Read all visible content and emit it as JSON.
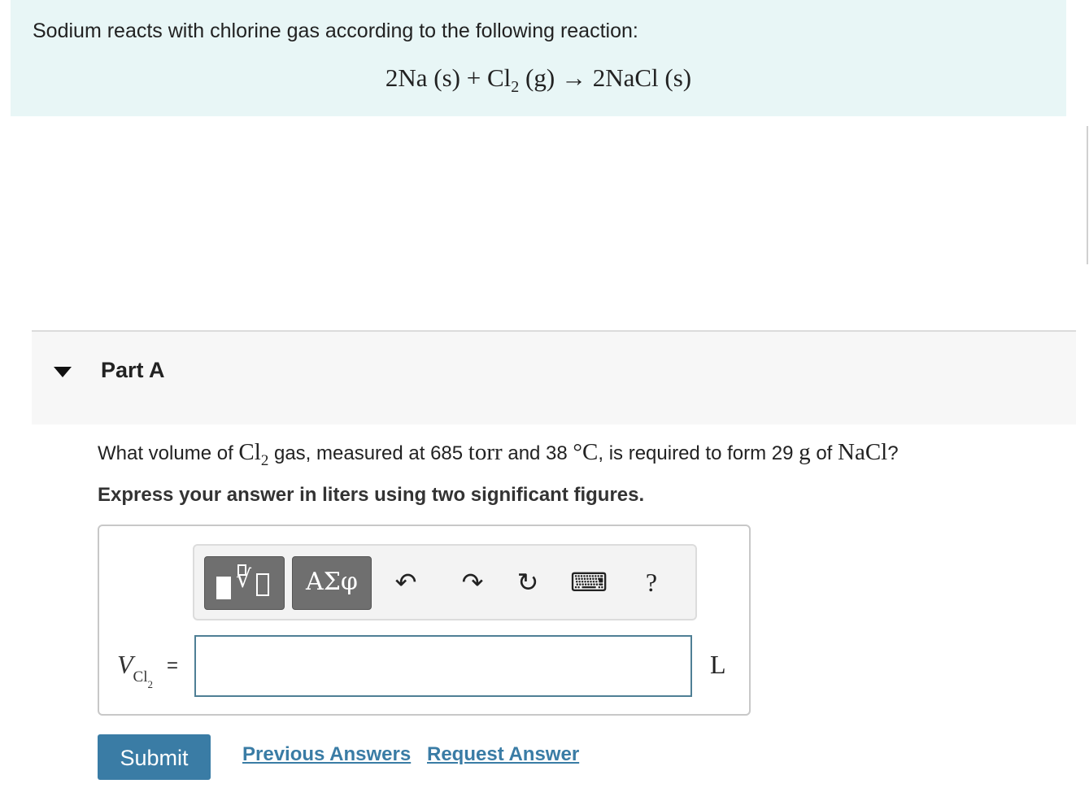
{
  "intro": {
    "text": "Sodium reacts with chlorine gas according to the following reaction:",
    "equation": {
      "reactant1": "2Na (s) + Cl",
      "reactant1_sub": "2",
      "reactant2_state": " (g)",
      "arrow": " → ",
      "product": "2NaCl (s)"
    }
  },
  "part": {
    "title": "Part A"
  },
  "question": {
    "prefix": "What volume of ",
    "species": "Cl",
    "species_sub": "2",
    "mid1": " gas, measured at 685 ",
    "pressure_unit": "torr",
    "mid2": " and 38 ",
    "temp_unit": "°C",
    "mid3": ", is required to form 29 ",
    "mass_unit": "g",
    "mid4": " of ",
    "product": "NaCl",
    "suffix": "?"
  },
  "instruction": "Express your answer in liters using two significant figures.",
  "answer": {
    "variable": "V",
    "variable_sub": "Cl",
    "variable_sub_sub": "2",
    "equals": "=",
    "value": "",
    "unit": "L"
  },
  "toolbar": {
    "symbols_label": "ΑΣφ",
    "undo_icon": "↶",
    "redo_icon": "↷",
    "reset_icon": "↻",
    "keyboard_icon": "⌨",
    "help_label": "?"
  },
  "actions": {
    "submit": "Submit",
    "previous_answers": "Previous Answers",
    "request_answer": "Request Answer"
  }
}
